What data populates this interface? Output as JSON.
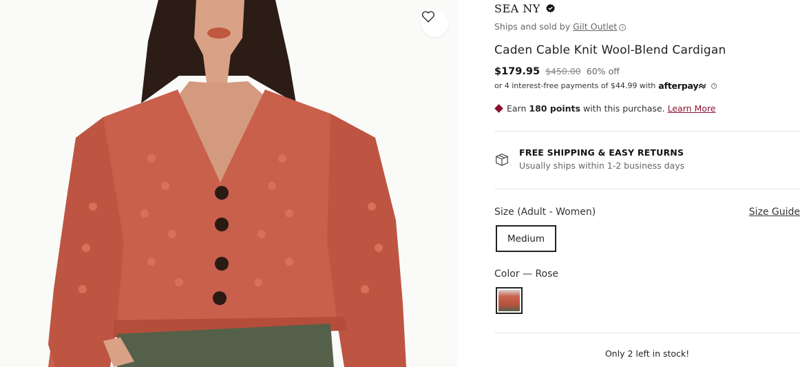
{
  "product": {
    "brand": "SEA NY",
    "seller_prefix": "Ships and sold by ",
    "seller_name": "Gilt Outlet",
    "title": "Caden Cable Knit Wool-Blend Cardigan",
    "price": "$179.95",
    "msrp": "$450.00",
    "discount": "60% off",
    "installments_text": "or 4 interest-free payments of $44.99 with",
    "afterpay_label": "afterpay",
    "points_prefix": "Earn",
    "points_value": "180 points",
    "points_suffix": "with this purchase.",
    "points_link": "Learn More"
  },
  "shipping": {
    "title": "FREE SHIPPING & EASY RETURNS",
    "subtitle": "Usually ships within 1-2 business days"
  },
  "size": {
    "label": "Size (Adult - Women)",
    "guide_link": "Size Guide",
    "selected": "Medium"
  },
  "color": {
    "label": "Color — Rose"
  },
  "stock": "Only 2 left in stock!",
  "icons": {
    "wishlist": "heart-icon",
    "verified": "verified-badge-icon",
    "info": "info-icon",
    "shipping": "box-icon",
    "points": "diamond-icon"
  },
  "colors": {
    "accent": "#8b1132",
    "sweater": "#c9604c",
    "pants": "#55604a"
  }
}
